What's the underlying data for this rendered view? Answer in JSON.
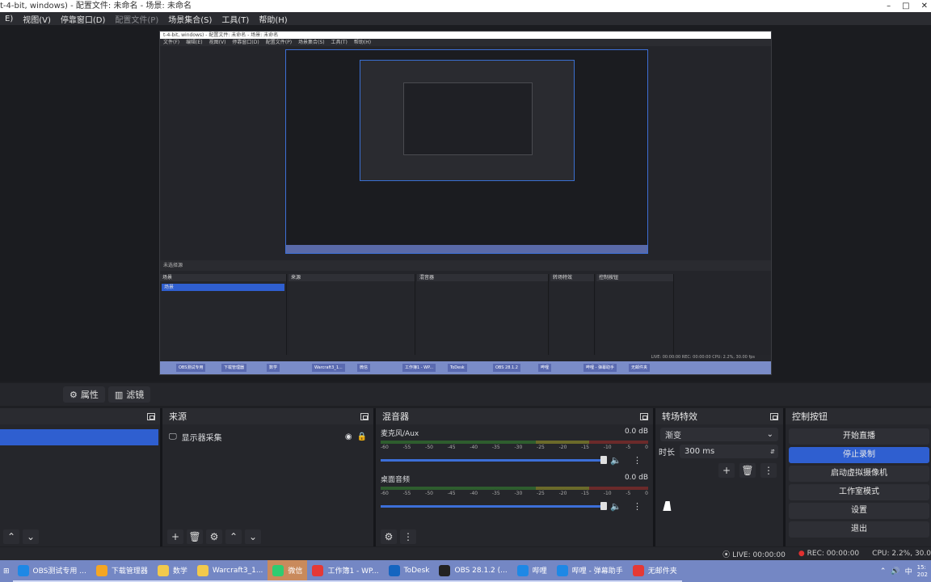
{
  "window": {
    "title": "t-4-bit, windows) - 配置文件: 未命名 - 场景: 未命名"
  },
  "menu": [
    {
      "label": "E)",
      "dim": false
    },
    {
      "label": "视图(V)",
      "dim": false
    },
    {
      "label": "停靠窗口(D)",
      "dim": false
    },
    {
      "label": "配置文件(P)",
      "dim": true
    },
    {
      "label": "场景集合(S)",
      "dim": false
    },
    {
      "label": "工具(T)",
      "dim": false
    },
    {
      "label": "帮助(H)",
      "dim": false
    }
  ],
  "nested": {
    "menu": [
      "文件(F)",
      "编辑(E)",
      "视图(V)",
      "停靠窗口(D)",
      "配置文件(P)",
      "场景集合(S)",
      "工具(T)",
      "帮助(H)"
    ],
    "strip": "未选择源",
    "panels": [
      "场景",
      "来源",
      "混音器",
      "转场特效",
      "控制按钮"
    ],
    "sel_scene": "场景",
    "status": "LIVE: 00:00:00   REC: 00:00:00   CPU: 2.2%, 30.00 fps",
    "tasks": [
      "OBS测试专用",
      "下载管理器",
      "数学",
      "Warcraft3_1...",
      "微信",
      "工作簿1 - WP...",
      "ToDesk",
      "OBS 28.1.2",
      "哔哩",
      "哔哩 - 弹幕助手",
      "无邮件夹"
    ]
  },
  "props": {
    "properties": "属性",
    "filters": "滤镜"
  },
  "docks": {
    "sources": {
      "title": "来源",
      "item": "显示器采集"
    },
    "mixer": {
      "title": "混音器",
      "channels": [
        {
          "name": "麦克风/Aux",
          "db": "0.0 dB"
        },
        {
          "name": "桌面音频",
          "db": "0.0 dB"
        }
      ],
      "scale": [
        "-60",
        "-55",
        "-50",
        "-45",
        "-40",
        "-35",
        "-30",
        "-25",
        "-20",
        "-15",
        "-10",
        "-5",
        "0"
      ]
    },
    "transitions": {
      "title": "转场特效",
      "selected": "渐变",
      "duration_label": "时长",
      "duration": "300 ms"
    },
    "controls": {
      "title": "控制按钮",
      "buttons": [
        "开始直播",
        "停止录制",
        "启动虚拟摄像机",
        "工作室模式",
        "设置",
        "退出"
      ]
    }
  },
  "status": {
    "live": "LIVE: 00:00:00",
    "rec": "REC: 00:00:00",
    "cpu": "CPU: 2.2%, 30.0"
  },
  "taskbar": {
    "items": [
      {
        "label": "OBS测试专用 ...",
        "color": "#1e88e5"
      },
      {
        "label": "下载管理器",
        "color": "#f5a623"
      },
      {
        "label": "数学",
        "color": "#f2c94c"
      },
      {
        "label": "Warcraft3_1...",
        "color": "#f2c94c"
      },
      {
        "label": "微信",
        "color": "#2ecc71"
      },
      {
        "label": "工作簿1 - WP...",
        "color": "#e53935"
      },
      {
        "label": "ToDesk",
        "color": "#1565c0"
      },
      {
        "label": "OBS 28.1.2 (...",
        "color": "#222222"
      },
      {
        "label": "哔哩",
        "color": "#1e88e5"
      },
      {
        "label": "哔哩 - 弹幕助手",
        "color": "#1e88e5"
      },
      {
        "label": "无邮件夹",
        "color": "#e53935"
      }
    ],
    "tray_lang": "中",
    "clock_time": "15:",
    "clock_date": "202"
  },
  "colors": {
    "accent": "#2f5fd0",
    "panel": "#25262b",
    "taskbar": "#7487c4"
  }
}
